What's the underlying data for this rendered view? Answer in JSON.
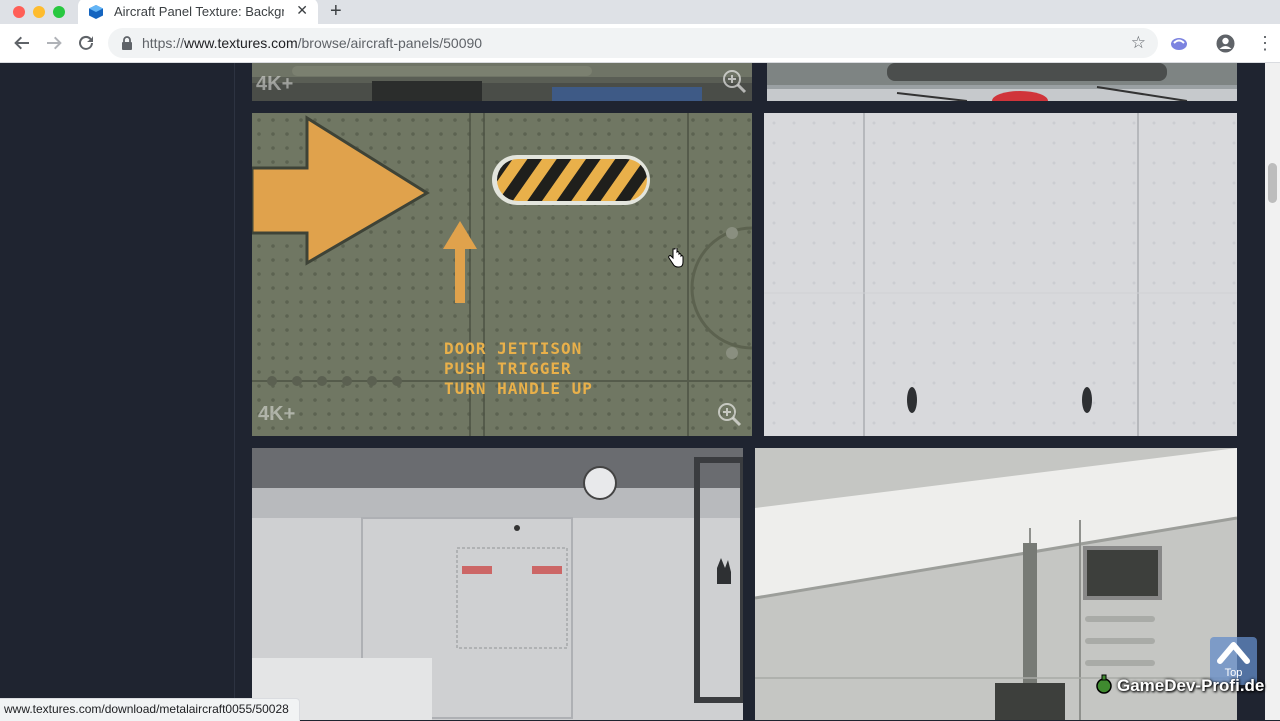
{
  "browser": {
    "tab_title": "Aircraft Panel Texture: Backgro",
    "url_scheme": "https://",
    "url_host": "www.textures.com",
    "url_path": "/browse/aircraft-panels/50090",
    "status_url": "www.textures.com/download/metalaircraft0055/50028"
  },
  "page": {
    "thumbnails": [
      {
        "badge": "4K+",
        "has_zoom": true
      },
      {
        "badge": "",
        "has_zoom": false
      },
      {
        "badge": "4K+",
        "has_zoom": true,
        "stencil_lines": [
          "DOOR JETTISON",
          "PUSH TRIGGER",
          "TURN HANDLE UP"
        ]
      },
      {
        "badge": "",
        "has_zoom": false
      },
      {
        "badge": "",
        "has_zoom": false
      },
      {
        "badge": "",
        "has_zoom": false
      }
    ],
    "top_button_label": "Top",
    "watermark": "GameDev-Profi.de"
  },
  "colors": {
    "sidebar_bg": "#1f2430",
    "accent_blue": "#1a73e8",
    "stencil_yellow": "#e9b04a"
  }
}
